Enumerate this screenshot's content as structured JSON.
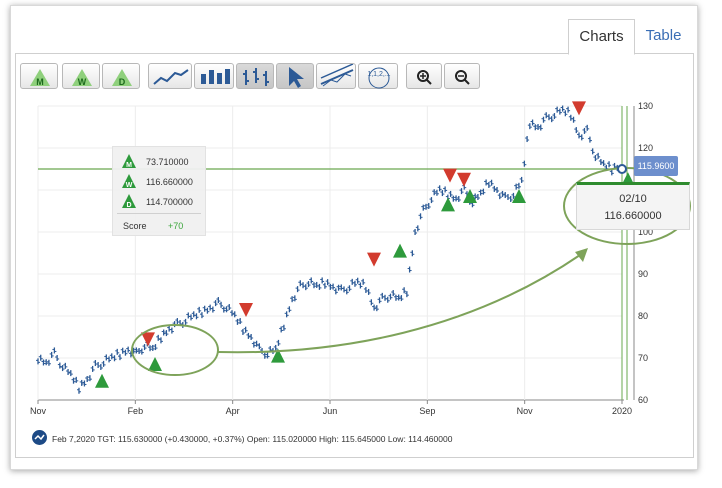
{
  "tabs": {
    "charts": "Charts",
    "table": "Table"
  },
  "toolbar": {
    "period_buttons": [
      "M",
      "W",
      "D"
    ],
    "tools": [
      "line-chart",
      "bar-chart",
      "ohlc-chart",
      "pointer",
      "trendline",
      "fibonacci",
      "zoom-in",
      "zoom-out"
    ],
    "fib_label": "1,1,2,..."
  },
  "legend": {
    "rows": [
      {
        "icon": "M",
        "value": "73.710000"
      },
      {
        "icon": "W",
        "value": "116.660000"
      },
      {
        "icon": "D",
        "value": "114.700000"
      }
    ],
    "score_label": "Score",
    "score_value": "+70"
  },
  "tooltip": {
    "date": "02/10",
    "value": "116.660000"
  },
  "price_tag": "115.9600",
  "footer": "Feb 7,2020 TGT: 115.630000 (+0.430000, +0.37%) Open: 115.020000 High: 115.645000 Low: 114.460000",
  "colors": {
    "price": "#2c5a96",
    "buy": "#2e9a3c",
    "sell": "#d23b2e",
    "annotation": "#6b9a4a",
    "hline": "#6aa84f",
    "tag": "#6d8fcd"
  },
  "chart_data": {
    "type": "ohlc",
    "title": "",
    "x_tick_labels": [
      "Nov",
      "Feb",
      "Apr",
      "Jun",
      "Sep",
      "Nov",
      "2020"
    ],
    "y_tick_labels": [
      "60",
      "70",
      "80",
      "90",
      "100",
      "110",
      "120",
      "130"
    ],
    "ylim": [
      60,
      130
    ],
    "grid": true,
    "horizontal_line": 116.66,
    "series": [
      {
        "values": [
          [
            0,
            70
          ],
          [
            3,
            69
          ],
          [
            6,
            71
          ],
          [
            9,
            68
          ],
          [
            12,
            66
          ],
          [
            15,
            63
          ],
          [
            18,
            65
          ],
          [
            21,
            68
          ],
          [
            24,
            69
          ],
          [
            27,
            70
          ],
          [
            30,
            71
          ],
          [
            33,
            72
          ],
          [
            36,
            71
          ],
          [
            39,
            73
          ],
          [
            42,
            72
          ],
          [
            45,
            75
          ],
          [
            48,
            77
          ],
          [
            51,
            78
          ],
          [
            54,
            79
          ],
          [
            57,
            80
          ],
          [
            60,
            81
          ],
          [
            63,
            82
          ],
          [
            66,
            83
          ],
          [
            69,
            82
          ],
          [
            72,
            80
          ],
          [
            75,
            77
          ],
          [
            78,
            75
          ],
          [
            81,
            72
          ],
          [
            84,
            71
          ],
          [
            87,
            72
          ],
          [
            90,
            78
          ],
          [
            93,
            84
          ],
          [
            96,
            87
          ],
          [
            99,
            88
          ],
          [
            102,
            87
          ],
          [
            105,
            88
          ],
          [
            108,
            87
          ],
          [
            111,
            86
          ],
          [
            114,
            87
          ],
          [
            117,
            88
          ],
          [
            120,
            87
          ],
          [
            123,
            82
          ],
          [
            126,
            84
          ],
          [
            129,
            85
          ],
          [
            132,
            84
          ],
          [
            135,
            86
          ],
          [
            138,
            100
          ],
          [
            141,
            105
          ],
          [
            144,
            108
          ],
          [
            147,
            110
          ],
          [
            150,
            109
          ],
          [
            153,
            108
          ],
          [
            156,
            110
          ],
          [
            159,
            107
          ],
          [
            162,
            109
          ],
          [
            165,
            112
          ],
          [
            168,
            110
          ],
          [
            171,
            108
          ],
          [
            174,
            109
          ],
          [
            177,
            112
          ],
          [
            180,
            126
          ],
          [
            183,
            125
          ],
          [
            186,
            127
          ],
          [
            189,
            128
          ],
          [
            192,
            129
          ],
          [
            195,
            128
          ],
          [
            198,
            123
          ],
          [
            201,
            124
          ],
          [
            204,
            118
          ],
          [
            207,
            116
          ],
          [
            210,
            115
          ],
          [
            213,
            116
          ]
        ]
      }
    ],
    "signals": {
      "buy": [
        [
          "Dec",
          65
        ],
        [
          "Feb",
          70
        ],
        [
          "Apr",
          72
        ],
        [
          "Aug",
          97
        ],
        [
          "Sep",
          108
        ],
        [
          "Oct",
          110
        ],
        [
          "Nov",
          110
        ],
        [
          "Jan",
          114
        ]
      ],
      "sell": [
        [
          "Feb",
          73
        ],
        [
          "Mar",
          80
        ],
        [
          "Jul",
          92
        ],
        [
          "Sep",
          112
        ],
        [
          "Oct",
          111
        ],
        [
          "Dec",
          128
        ]
      ]
    }
  }
}
